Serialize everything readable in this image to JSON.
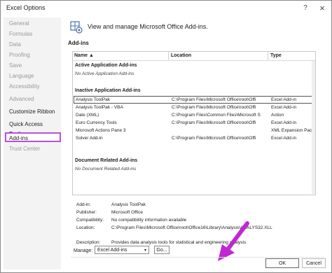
{
  "window": {
    "title": "Excel Options",
    "help_glyph": "?",
    "close_glyph": "×"
  },
  "sidebar": {
    "items": [
      {
        "label": "General",
        "state": "disabled"
      },
      {
        "label": "Formulas",
        "state": "disabled"
      },
      {
        "label": "Data",
        "state": "disabled"
      },
      {
        "label": "Proofing",
        "state": "disabled"
      },
      {
        "label": "Save",
        "state": "disabled"
      },
      {
        "label": "Language",
        "state": "disabled"
      },
      {
        "label": "Accessibility",
        "state": "disabled"
      },
      {
        "label": "Advanced",
        "state": "disabled"
      },
      {
        "label": "Customize Ribbon",
        "state": "enabled"
      },
      {
        "label": "Quick Access Toolbar",
        "state": "enabled"
      },
      {
        "label": "Add-ins",
        "state": "selected"
      },
      {
        "label": "Trust Center",
        "state": "disabled"
      }
    ]
  },
  "header": {
    "text": "View and manage Microsoft Office Add-ins."
  },
  "addins": {
    "section_title": "Add-ins",
    "columns": {
      "name": "Name ▲",
      "location": "Location",
      "type": "Type"
    },
    "active": {
      "title": "Active Application Add-ins",
      "empty": "No Active Application Add-ins"
    },
    "inactive": {
      "title": "Inactive Application Add-ins",
      "rows": [
        {
          "name": "Analysis ToolPak",
          "location": "C:\\Program Files\\Microsoft Office\\root\\Offi",
          "type": "Excel Add-in"
        },
        {
          "name": "Analysis ToolPak - VBA",
          "location": "C:\\Program Files\\Microsoft Office\\root\\Offi",
          "type": "Excel Add-in"
        },
        {
          "name": "Date (XML)",
          "location": "C:\\Program Files\\Common Files\\Microsoft S",
          "type": "Action"
        },
        {
          "name": "Euro Currency Tools",
          "location": "C:\\Program Files\\Microsoft Office\\root\\Offi",
          "type": "Excel Add-in"
        },
        {
          "name": "Microsoft Actions Pane 3",
          "location": "",
          "type": "XML Expansion Pack"
        },
        {
          "name": "Solver Add-in",
          "location": "C:\\Program Files\\Microsoft Office\\root\\Offi",
          "type": "Excel Add-in"
        }
      ]
    },
    "document": {
      "title": "Document Related Add-ins",
      "empty": "No Document Related Add-ins"
    }
  },
  "details": {
    "addin_label": "Add-in:",
    "addin_value": "Analysis ToolPak",
    "publisher_label": "Publisher:",
    "publisher_value": "Microsoft Office",
    "compat_label": "Compatibility:",
    "compat_value": "No compatibility information available",
    "location_label": "Location:",
    "location_value": "C:\\Program Files\\Microsoft Office\\root\\Office16\\Library\\Analysis\\ANALYS32.XLL",
    "description_label": "Description:",
    "description_value": "Provides data analysis tools for statistical and engineering analysis"
  },
  "manage": {
    "label": "Manage:",
    "selected": "Excel Add-ins",
    "chevron": "▾",
    "go_label": "Go..."
  },
  "footer": {
    "ok_label": "OK",
    "cancel_label": "Cancel"
  },
  "colors": {
    "highlight": "#b94fe0",
    "arrow": "#c026d3"
  }
}
